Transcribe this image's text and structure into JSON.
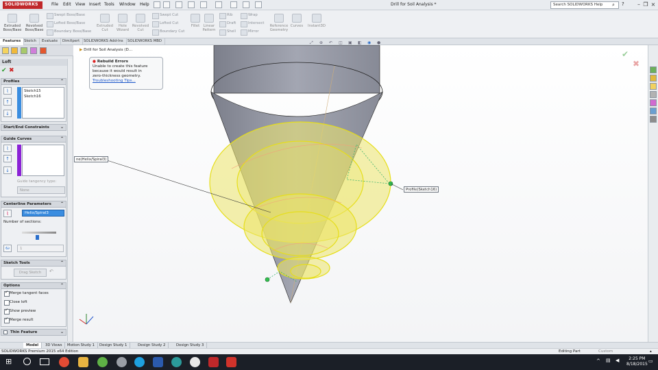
{
  "app": {
    "logo": "SOLIDWORKS",
    "doc_title": "Drill for Soil Analysis *"
  },
  "menu": [
    "File",
    "Edit",
    "View",
    "Insert",
    "Tools",
    "Window",
    "Help"
  ],
  "search": {
    "placeholder": "Search SOLIDWORKS Help"
  },
  "ribbon": {
    "large": [
      {
        "label": "Extruded Boss/Base"
      },
      {
        "label": "Revolved Boss/Base"
      },
      {
        "label": "Extruded Cut"
      },
      {
        "label": "Hole Wizard"
      },
      {
        "label": "Revolved Cut"
      },
      {
        "label": "Fillet"
      },
      {
        "label": "Linear Pattern"
      },
      {
        "label": "Reference Geometry"
      },
      {
        "label": "Curves"
      },
      {
        "label": "Instant3D"
      }
    ],
    "small": [
      "Swept Boss/Base",
      "Lofted Boss/Base",
      "Boundary Boss/Base",
      "Swept Cut",
      "Lofted Cut",
      "Boundary Cut",
      "Rib",
      "Draft",
      "Shell",
      "Wrap",
      "Intersect",
      "Mirror"
    ]
  },
  "command_tabs": [
    "Features",
    "Sketch",
    "Evaluate",
    "DimXpert",
    "SOLIDWORKS Add-Ins",
    "SOLIDWORKS MBD"
  ],
  "tree_path": "Drill for Soil Analysis (D...",
  "property_manager": {
    "title": "Loft",
    "profiles": {
      "header": "Profiles",
      "items": [
        "Sketch15",
        "Sketch16"
      ]
    },
    "start_end": {
      "header": "Start/End Constraints"
    },
    "guide_curves": {
      "header": "Guide Curves",
      "tangency_label": "Guide tangency type:",
      "tangency_value": "None"
    },
    "centerline": {
      "header": "Centerline Parameters",
      "value": "Helix/Spiral3",
      "sections_label": "Number of sections:",
      "sections_value": "1"
    },
    "sketch_tools": {
      "header": "Sketch Tools",
      "drag_sketch": "Drag Sketch"
    },
    "options": {
      "header": "Options",
      "items": [
        {
          "label": "Merge tangent faces",
          "checked": true
        },
        {
          "label": "Close loft",
          "checked": false
        },
        {
          "label": "Show preview",
          "checked": true
        },
        {
          "label": "Merge result",
          "checked": true
        }
      ]
    },
    "thin_feature": {
      "header": "Thin Feature"
    }
  },
  "rebuild_popup": {
    "title": "Rebuild Errors",
    "body": [
      "Unable to create this feature",
      "because it would result in",
      "zero-thickness geometry."
    ],
    "link": "Troubleshooting Tips..."
  },
  "callouts": {
    "centerline": "ne(Helix/Spiral3)",
    "profile": "Profile(Sketch16)"
  },
  "bottom_tabs": [
    "Model",
    "3D Views",
    "Motion Study 1",
    "Design Study 1",
    "Design Study 2",
    "Design Study 3"
  ],
  "status": {
    "left": "SOLIDWORKS Premium 2015 x64 Edition",
    "mode": "Editing Part",
    "units": "Custom"
  },
  "clock": {
    "time": "2:25 PM",
    "date": "8/18/2015"
  },
  "colors": {
    "accent": "#c0282a",
    "loft_preview": "#e8e23a",
    "cone": "#8d8f9b"
  }
}
